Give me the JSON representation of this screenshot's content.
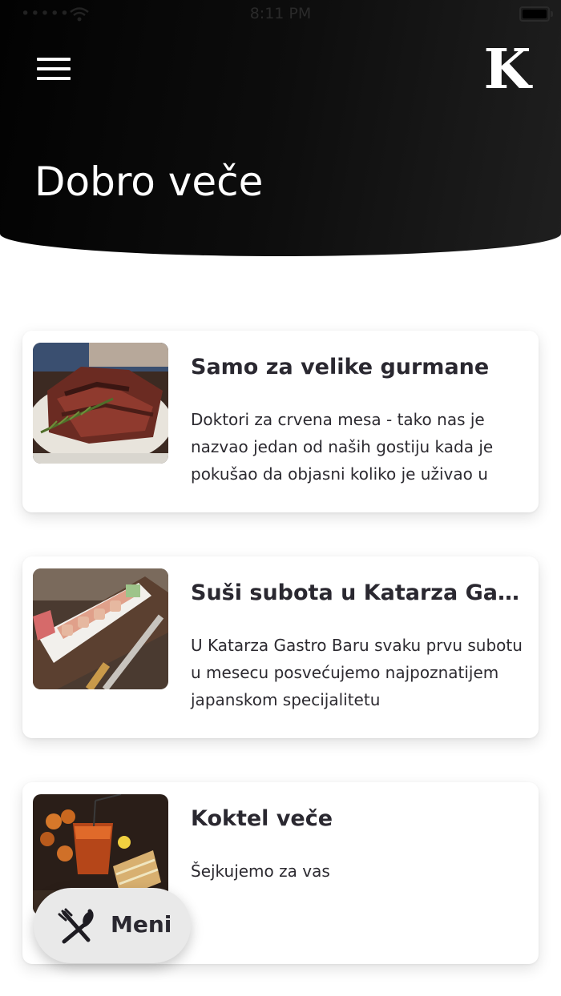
{
  "status_bar": {
    "carrier": "•••••",
    "time": "8:11 PM",
    "icons": [
      "wifi-icon",
      "battery-icon"
    ]
  },
  "header": {
    "menu_icon": "hamburger-menu-icon",
    "logo_text": "K",
    "greeting": "Dobro veče"
  },
  "cards": [
    {
      "title": "Samo za velike gurmane",
      "description": "Doktori za crvena mesa - tako nas je nazvao jedan od naših gostiju kada je pokušao da objasni koliko je uživao u",
      "image": "steak-photo"
    },
    {
      "title": "Suši subota u Katarza Gastro Baru",
      "description": "U Katarza Gastro Baru svaku prvu subotu u mesecu posvećujemo najpoznatijem japanskom specijalitetu",
      "image": "sushi-photo"
    },
    {
      "title": "Koktel veče",
      "description": "Šejkujemo za vas",
      "image": "cocktail-photo"
    }
  ],
  "fab": {
    "label": "Meni",
    "icon": "fork-knife-icon"
  },
  "colors": {
    "header_bg": "#0a0a0a",
    "card_bg": "#ffffff",
    "fab_bg": "#e9e9e9",
    "text_dark": "#2a2830"
  }
}
